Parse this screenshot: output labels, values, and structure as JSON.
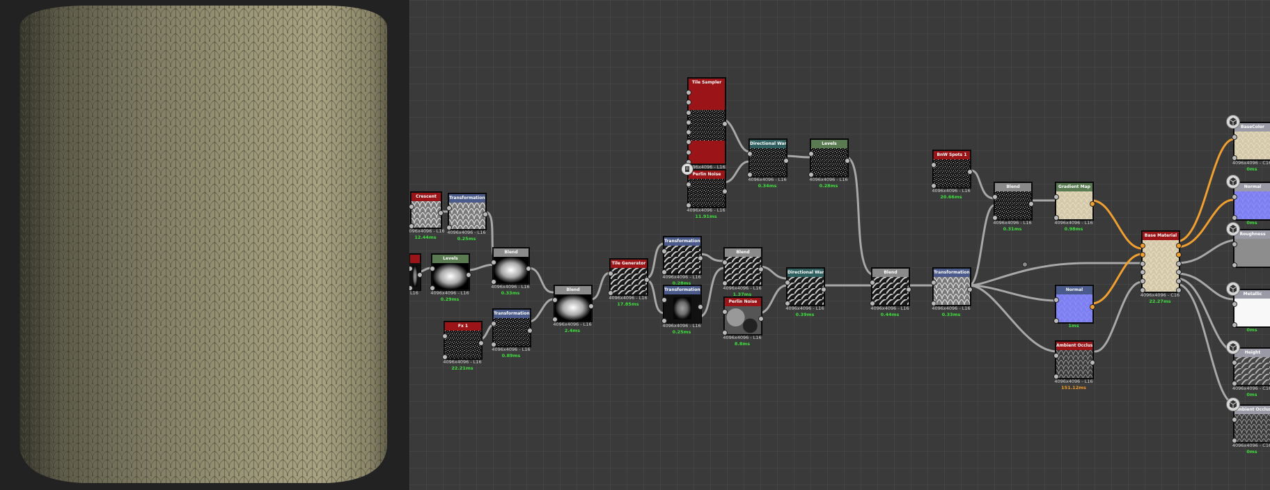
{
  "colors": {
    "header_red": "#9b1518",
    "header_blue": "#4a5a8a",
    "header_gray": "#8a8a8a",
    "header_green": "#5a7a52",
    "header_teal": "#2f5f5f",
    "header_light": "#9a9aa6",
    "time_green": "#3fe03f",
    "time_orange": "#f39c2a",
    "wire_gray": "#a8a8a8",
    "wire_orange": "#f0a030"
  },
  "viewport": {
    "material": "knit wool cylinder preview"
  },
  "nodes": [
    {
      "id": "n_cloud",
      "title": "Crescent",
      "header": "red",
      "thumb": "knit",
      "res": "4096x4096 - L16",
      "time": "12.44ms",
      "time_color": "green"
    },
    {
      "id": "n_t2d_a",
      "title": "Transformation 2D",
      "header": "blue",
      "thumb": "knit",
      "res": "4096x4096 - L16",
      "time": "0.25ms",
      "time_color": "green"
    },
    {
      "id": "n_left",
      "title": "",
      "header": "red",
      "thumb": "dark",
      "res": "L16",
      "time": "",
      "time_color": "green"
    },
    {
      "id": "n_levels_a",
      "title": "Levels",
      "header": "green",
      "thumb": "blob",
      "res": "4096x4096 - L16",
      "time": "0.29ms",
      "time_color": "green"
    },
    {
      "id": "n_blend_a",
      "title": "Blend",
      "header": "gray",
      "thumb": "blob",
      "res": "4096x4096 - L16",
      "time": "0.33ms",
      "time_color": "green"
    },
    {
      "id": "n_fx",
      "title": "Fx 1",
      "header": "red",
      "thumb": "noise",
      "res": "4096x4096 - L16",
      "time": "22.21ms",
      "time_color": "green"
    },
    {
      "id": "n_t2d_b",
      "title": "Transformation 2D",
      "header": "blue",
      "thumb": "noise",
      "res": "4096x4096 - L16",
      "time": "0.89ms",
      "time_color": "green"
    },
    {
      "id": "n_blend_b",
      "title": "Blend",
      "header": "gray",
      "thumb": "blob",
      "res": "4096x4096 - L16",
      "time": "2.4ms",
      "time_color": "green"
    },
    {
      "id": "n_tile",
      "title": "Tile Generator",
      "header": "red",
      "thumb": "strands",
      "res": "4096x4096 - L16",
      "time": "17.85ms",
      "time_color": "green"
    },
    {
      "id": "n_t2d_c",
      "title": "Transformation 2D",
      "header": "blue",
      "thumb": "strands",
      "res": "4096x4096 - L16",
      "time": "0.28ms",
      "time_color": "green"
    },
    {
      "id": "n_t2d_d",
      "title": "Transformation 2D",
      "header": "blue",
      "thumb": "dark",
      "res": "4096x4096 - L16",
      "time": "0.25ms",
      "time_color": "green"
    },
    {
      "id": "n_blend_c",
      "title": "Blend",
      "header": "gray",
      "thumb": "strands",
      "res": "4096x4096 - L16",
      "time": "1.37ms",
      "time_color": "green"
    },
    {
      "id": "n_perlin_a",
      "title": "Perlin Noise",
      "header": "red",
      "thumb": "blur",
      "res": "4096x4096 - L16",
      "time": "8.8ms",
      "time_color": "green"
    },
    {
      "id": "n_tsampler",
      "title": "Tile Sampler",
      "header": "red",
      "thumb": "noise",
      "res": "4096x4096 - L16",
      "time": "",
      "time_color": "green"
    },
    {
      "id": "n_perlin_b",
      "title": "Perlin Noise",
      "header": "red",
      "thumb": "noise",
      "res": "4096x4096 - L16",
      "time": "11.91ms",
      "time_color": "green"
    },
    {
      "id": "n_dwarp_a",
      "title": "Directional Warp",
      "header": "teal",
      "thumb": "noise",
      "res": "4096x4096 - L16",
      "time": "0.34ms",
      "time_color": "green"
    },
    {
      "id": "n_levels_b",
      "title": "Levels",
      "header": "green",
      "thumb": "noise",
      "res": "4096x4096 - L16",
      "time": "0.28ms",
      "time_color": "green"
    },
    {
      "id": "n_dwarp_b",
      "title": "Directional Warp",
      "header": "teal",
      "thumb": "strands",
      "res": "4096x4096 - L16",
      "time": "0.39ms",
      "time_color": "green"
    },
    {
      "id": "n_blend_d",
      "title": "Blend",
      "header": "gray",
      "thumb": "strands",
      "res": "4096x4096 - L16",
      "time": "0.44ms",
      "time_color": "green"
    },
    {
      "id": "n_t2d_e",
      "title": "Transformation 2D",
      "header": "blue",
      "thumb": "knit",
      "res": "4096x4096 - L16",
      "time": "0.33ms",
      "time_color": "green"
    },
    {
      "id": "n_bnoise",
      "title": "BnW Spots 1",
      "header": "red",
      "thumb": "noise",
      "res": "4096x4096 - L16",
      "time": "20.66ms",
      "time_color": "green"
    },
    {
      "id": "n_blend_e",
      "title": "Blend",
      "header": "gray",
      "thumb": "noise",
      "res": "4096x4096 - L16",
      "time": "0.31ms",
      "time_color": "green"
    },
    {
      "id": "n_gmap",
      "title": "Gradient Map",
      "header": "green",
      "thumb": "beige",
      "res": "4096x4096 - L16",
      "time": "0.98ms",
      "time_color": "green"
    },
    {
      "id": "n_normal",
      "title": "Normal",
      "header": "blue",
      "thumb": "normal",
      "res": "",
      "time": "1ms",
      "time_color": "green"
    },
    {
      "id": "n_ao",
      "title": "Ambient Occlusion (RT...)",
      "header": "red",
      "thumb": "aoknit",
      "res": "4096x4096 - L16",
      "time": "151.12ms",
      "time_color": "orange"
    },
    {
      "id": "n_basemat",
      "title": "Base Material",
      "header": "red",
      "thumb": "beige",
      "res": "4096x4096 - C16",
      "time": "22.27ms",
      "time_color": "green"
    },
    {
      "id": "o_basecolor",
      "title": "BaseColor",
      "header": "light",
      "thumb": "beige",
      "res": "4096x4096 - C16",
      "time": "0ms",
      "time_color": "green"
    },
    {
      "id": "o_normal",
      "title": "Normal",
      "header": "light",
      "thumb": "normal",
      "res": "",
      "time": "0ms",
      "time_color": "green"
    },
    {
      "id": "o_rough",
      "title": "Roughness",
      "header": "light",
      "thumb": "gray",
      "res": "",
      "time": "",
      "time_color": "green"
    },
    {
      "id": "o_metal",
      "title": "Metallic",
      "header": "light",
      "thumb": "white",
      "res": "",
      "time": "0ms",
      "time_color": "green"
    },
    {
      "id": "o_height",
      "title": "Height",
      "header": "light",
      "thumb": "strandsgray",
      "res": "4096x4096 - C16",
      "time": "0ms",
      "time_color": "green"
    },
    {
      "id": "o_ao",
      "title": "Ambient Occlusion",
      "header": "light",
      "thumb": "aoknit",
      "res": "4096x4096 - C16",
      "time": "0ms",
      "time_color": "green"
    }
  ]
}
